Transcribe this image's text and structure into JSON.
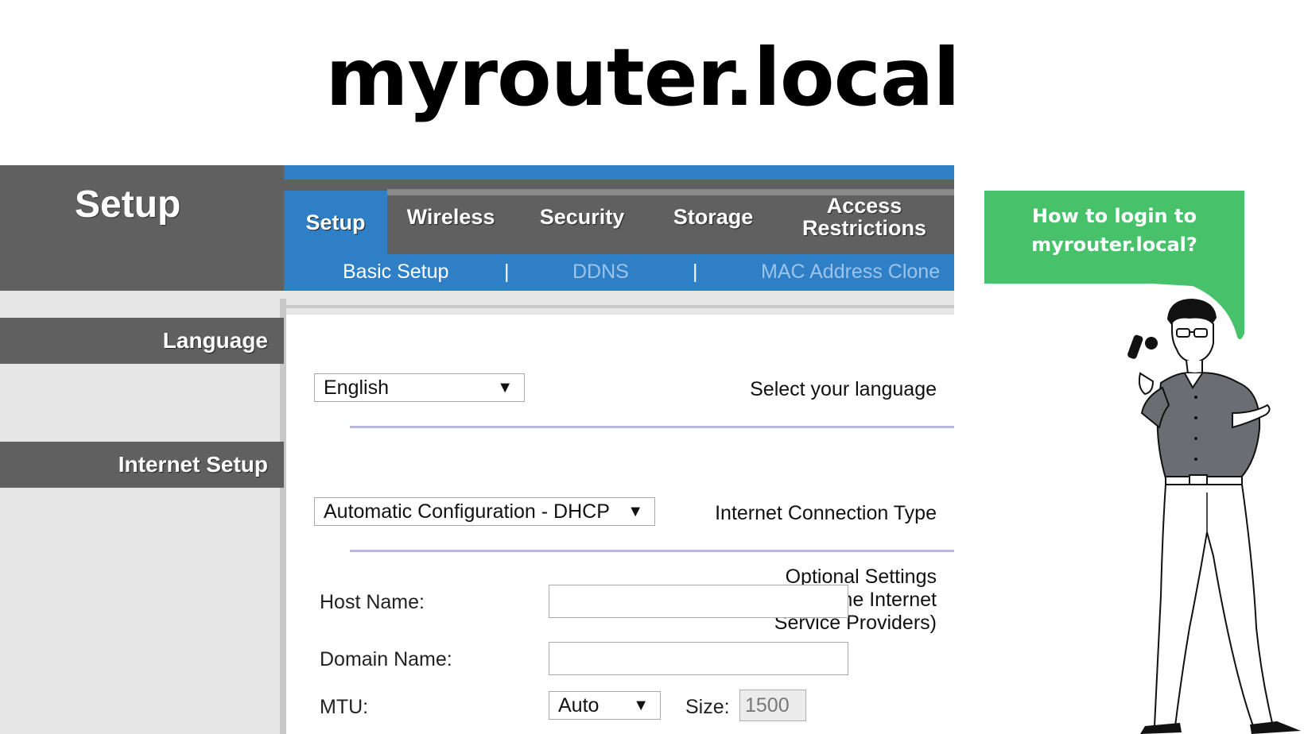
{
  "heading": "myrouter.local",
  "router": {
    "panel_title": "Setup",
    "tabs": [
      {
        "label": "Setup",
        "active": true
      },
      {
        "label": "Wireless",
        "active": false
      },
      {
        "label": "Security",
        "active": false
      },
      {
        "label": "Storage",
        "active": false
      },
      {
        "label": "Access Restrictions",
        "active": false
      }
    ],
    "subtabs": {
      "basic": "Basic Setup",
      "ddns": "DDNS",
      "mac": "MAC Address Clone",
      "separator": "|"
    },
    "sections": {
      "language": "Language",
      "internet": "Internet Setup"
    },
    "labels": {
      "select_language": "Select your language",
      "connection_type": "Internet Connection Type",
      "optional_1": "Optional Settings",
      "optional_2": "(required by some Internet",
      "optional_3": "Service Providers)"
    },
    "language_value": "English",
    "connection_value": "Automatic Configuration - DHCP",
    "form": {
      "host_label": "Host Name:",
      "host_value": "",
      "domain_label": "Domain Name:",
      "domain_value": "",
      "mtu_label": "MTU:",
      "mtu_value": "Auto",
      "size_label": "Size:",
      "size_value": "1500"
    },
    "dropdown_arrow": "▼"
  },
  "bubble": {
    "line1": "How to login to",
    "line2": "myrouter.local?"
  },
  "colors": {
    "tab_blue": "#2f7fc7",
    "dark_gray": "#606060",
    "bubble_green": "#47c16a"
  }
}
